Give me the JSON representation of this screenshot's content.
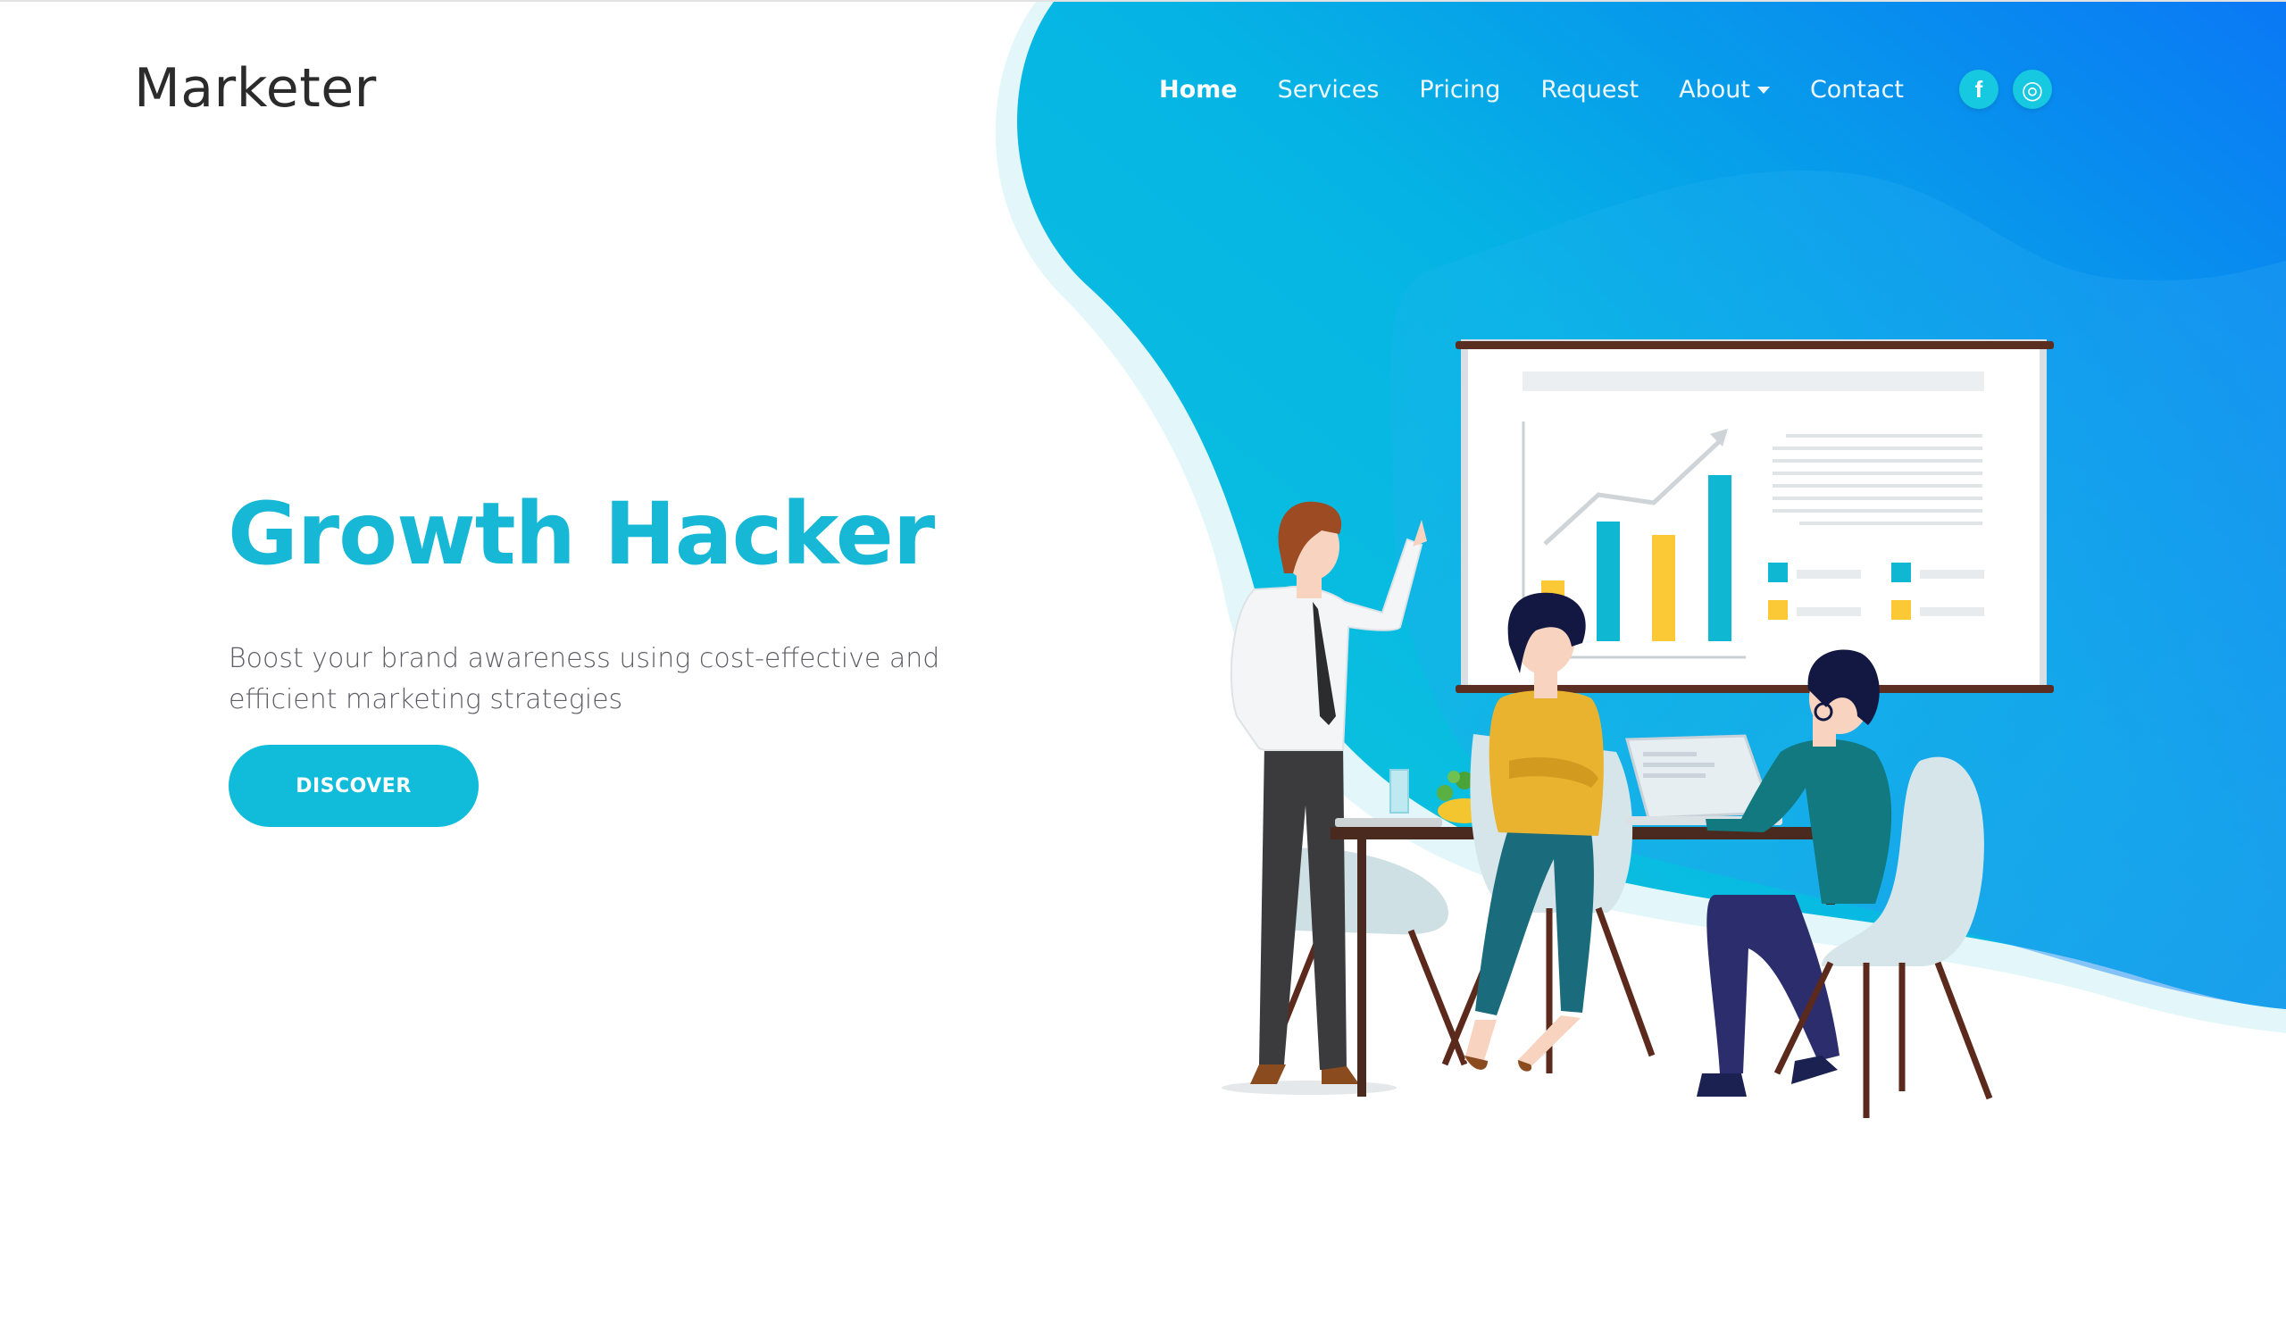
{
  "header": {
    "brand": "Marketer",
    "nav": [
      {
        "label": "Home",
        "active": true
      },
      {
        "label": "Services"
      },
      {
        "label": "Pricing"
      },
      {
        "label": "Request"
      },
      {
        "label": "About",
        "has_dropdown": true
      },
      {
        "label": "Contact"
      }
    ],
    "social": [
      {
        "icon": "facebook-icon",
        "glyph": "f"
      },
      {
        "icon": "instagram-icon",
        "glyph": "◎"
      }
    ]
  },
  "hero": {
    "title": "Growth Hacker",
    "subtitle": "Boost your brand awareness using cost-effective and efficient marketing strategies",
    "cta_label": "DISCOVER"
  },
  "colors": {
    "accent": "#17b8d6",
    "gradient_start": "#0ec6dc",
    "gradient_end": "#0a7cf2",
    "brand_text": "#2b2b2b"
  }
}
